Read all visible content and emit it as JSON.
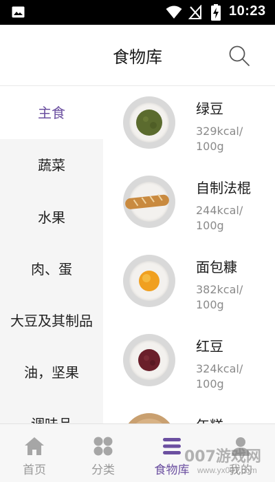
{
  "status_bar": {
    "time": "10:23",
    "icons": [
      "gallery-icon",
      "wifi-icon",
      "signal-off-icon",
      "battery-charging-icon"
    ]
  },
  "header": {
    "title": "食物库",
    "search_icon": "search-icon"
  },
  "categories": [
    {
      "label": "主食",
      "active": true
    },
    {
      "label": "蔬菜",
      "active": false
    },
    {
      "label": "水果",
      "active": false
    },
    {
      "label": "肉、蛋",
      "active": false
    },
    {
      "label": "大豆及其制品",
      "active": false
    },
    {
      "label": "油，坚果",
      "active": false
    },
    {
      "label": "调味品",
      "active": false
    }
  ],
  "foods": [
    {
      "name": "绿豆",
      "kcal": "329kcal/\n100g",
      "image": "mung-beans",
      "color": "#5b6b2e"
    },
    {
      "name": "自制法棍",
      "kcal": "244kcal/\n100g",
      "image": "baguette",
      "color": "#c98a3f"
    },
    {
      "name": "面包糠",
      "kcal": "382kcal/\n100g",
      "image": "breadcrumbs",
      "color": "#f0a020"
    },
    {
      "name": "红豆",
      "kcal": "324kcal/\n100g",
      "image": "red-beans",
      "color": "#6a1f2a"
    },
    {
      "name": "年糕",
      "kcal": "",
      "image": "rice-cake",
      "color": "#c9a070"
    }
  ],
  "bottom_nav": [
    {
      "label": "首页",
      "icon": "home-icon",
      "active": false
    },
    {
      "label": "分类",
      "icon": "category-grid-icon",
      "active": false
    },
    {
      "label": "食物库",
      "icon": "food-library-icon",
      "active": true
    },
    {
      "label": "我的",
      "icon": "profile-icon",
      "active": false
    }
  ],
  "watermark": {
    "text": "007游戏网",
    "url": "www.yx007.com"
  },
  "colors": {
    "accent": "#6b4fa0",
    "sidebar_bg": "#f5f5f5",
    "muted": "#8a8a8a"
  }
}
